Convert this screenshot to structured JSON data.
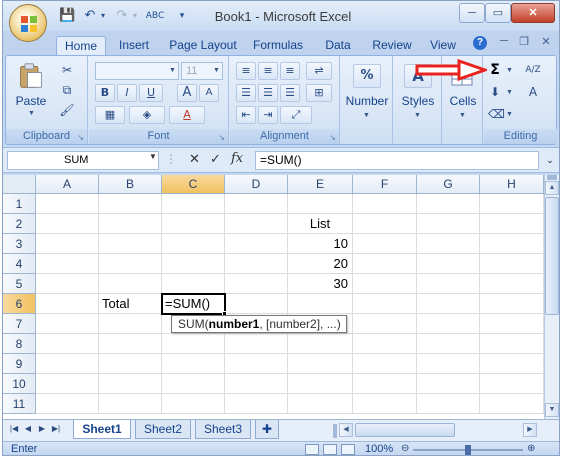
{
  "title_bar": {
    "title": "Book1 - Microsoft Excel",
    "spelling_icon_label": "ABC",
    "minimize": "─",
    "maximize": "▭",
    "close": "✕"
  },
  "ribbon_tabs": [
    "Home",
    "Insert",
    "Page Layout",
    "Formulas",
    "Data",
    "Review",
    "View"
  ],
  "active_tab": "Home",
  "help_label": "?",
  "ribbon": {
    "clipboard": {
      "label": "Clipboard",
      "paste_label": "Paste"
    },
    "font": {
      "label": "Font",
      "font_size": "11",
      "bold": "B",
      "italic": "I",
      "underline": "U",
      "grow": "A",
      "shrink": "A",
      "font_color": "A"
    },
    "alignment": {
      "label": "Alignment"
    },
    "number": {
      "label": "Number",
      "icon": "%"
    },
    "styles": {
      "label": "Styles",
      "icon": "A"
    },
    "cells": {
      "label": "Cells"
    },
    "editing": {
      "label": "Editing",
      "autosum": "Σ",
      "sort_icon": "A/Z",
      "find_icon": "A"
    }
  },
  "formula_bar": {
    "name_box": "SUM",
    "cancel": "✕",
    "enter": "✓",
    "fx": "fx",
    "formula": "=SUM()",
    "expand": "⌄"
  },
  "columns": [
    "A",
    "B",
    "C",
    "D",
    "E",
    "F",
    "G",
    "H"
  ],
  "rows": [
    "1",
    "2",
    "3",
    "4",
    "5",
    "6",
    "7",
    "8",
    "9",
    "10",
    "11"
  ],
  "cells": {
    "E2": "List",
    "E3": "10",
    "E4": "20",
    "E5": "30",
    "B6": "Total",
    "C6": "=SUM()"
  },
  "active_cell": "C6",
  "tooltip": {
    "prefix": "SUM(",
    "bold_arg": "number1",
    "rest": ", [number2], ...)"
  },
  "sheets": [
    "Sheet1",
    "Sheet2",
    "Sheet3"
  ],
  "active_sheet": "Sheet1",
  "status": {
    "mode": "Enter",
    "zoom": "100%"
  },
  "colors": {
    "annotation_arrow": "#e8231f",
    "selection_header": "#f1c15f",
    "ribbon_text": "#15428b"
  }
}
